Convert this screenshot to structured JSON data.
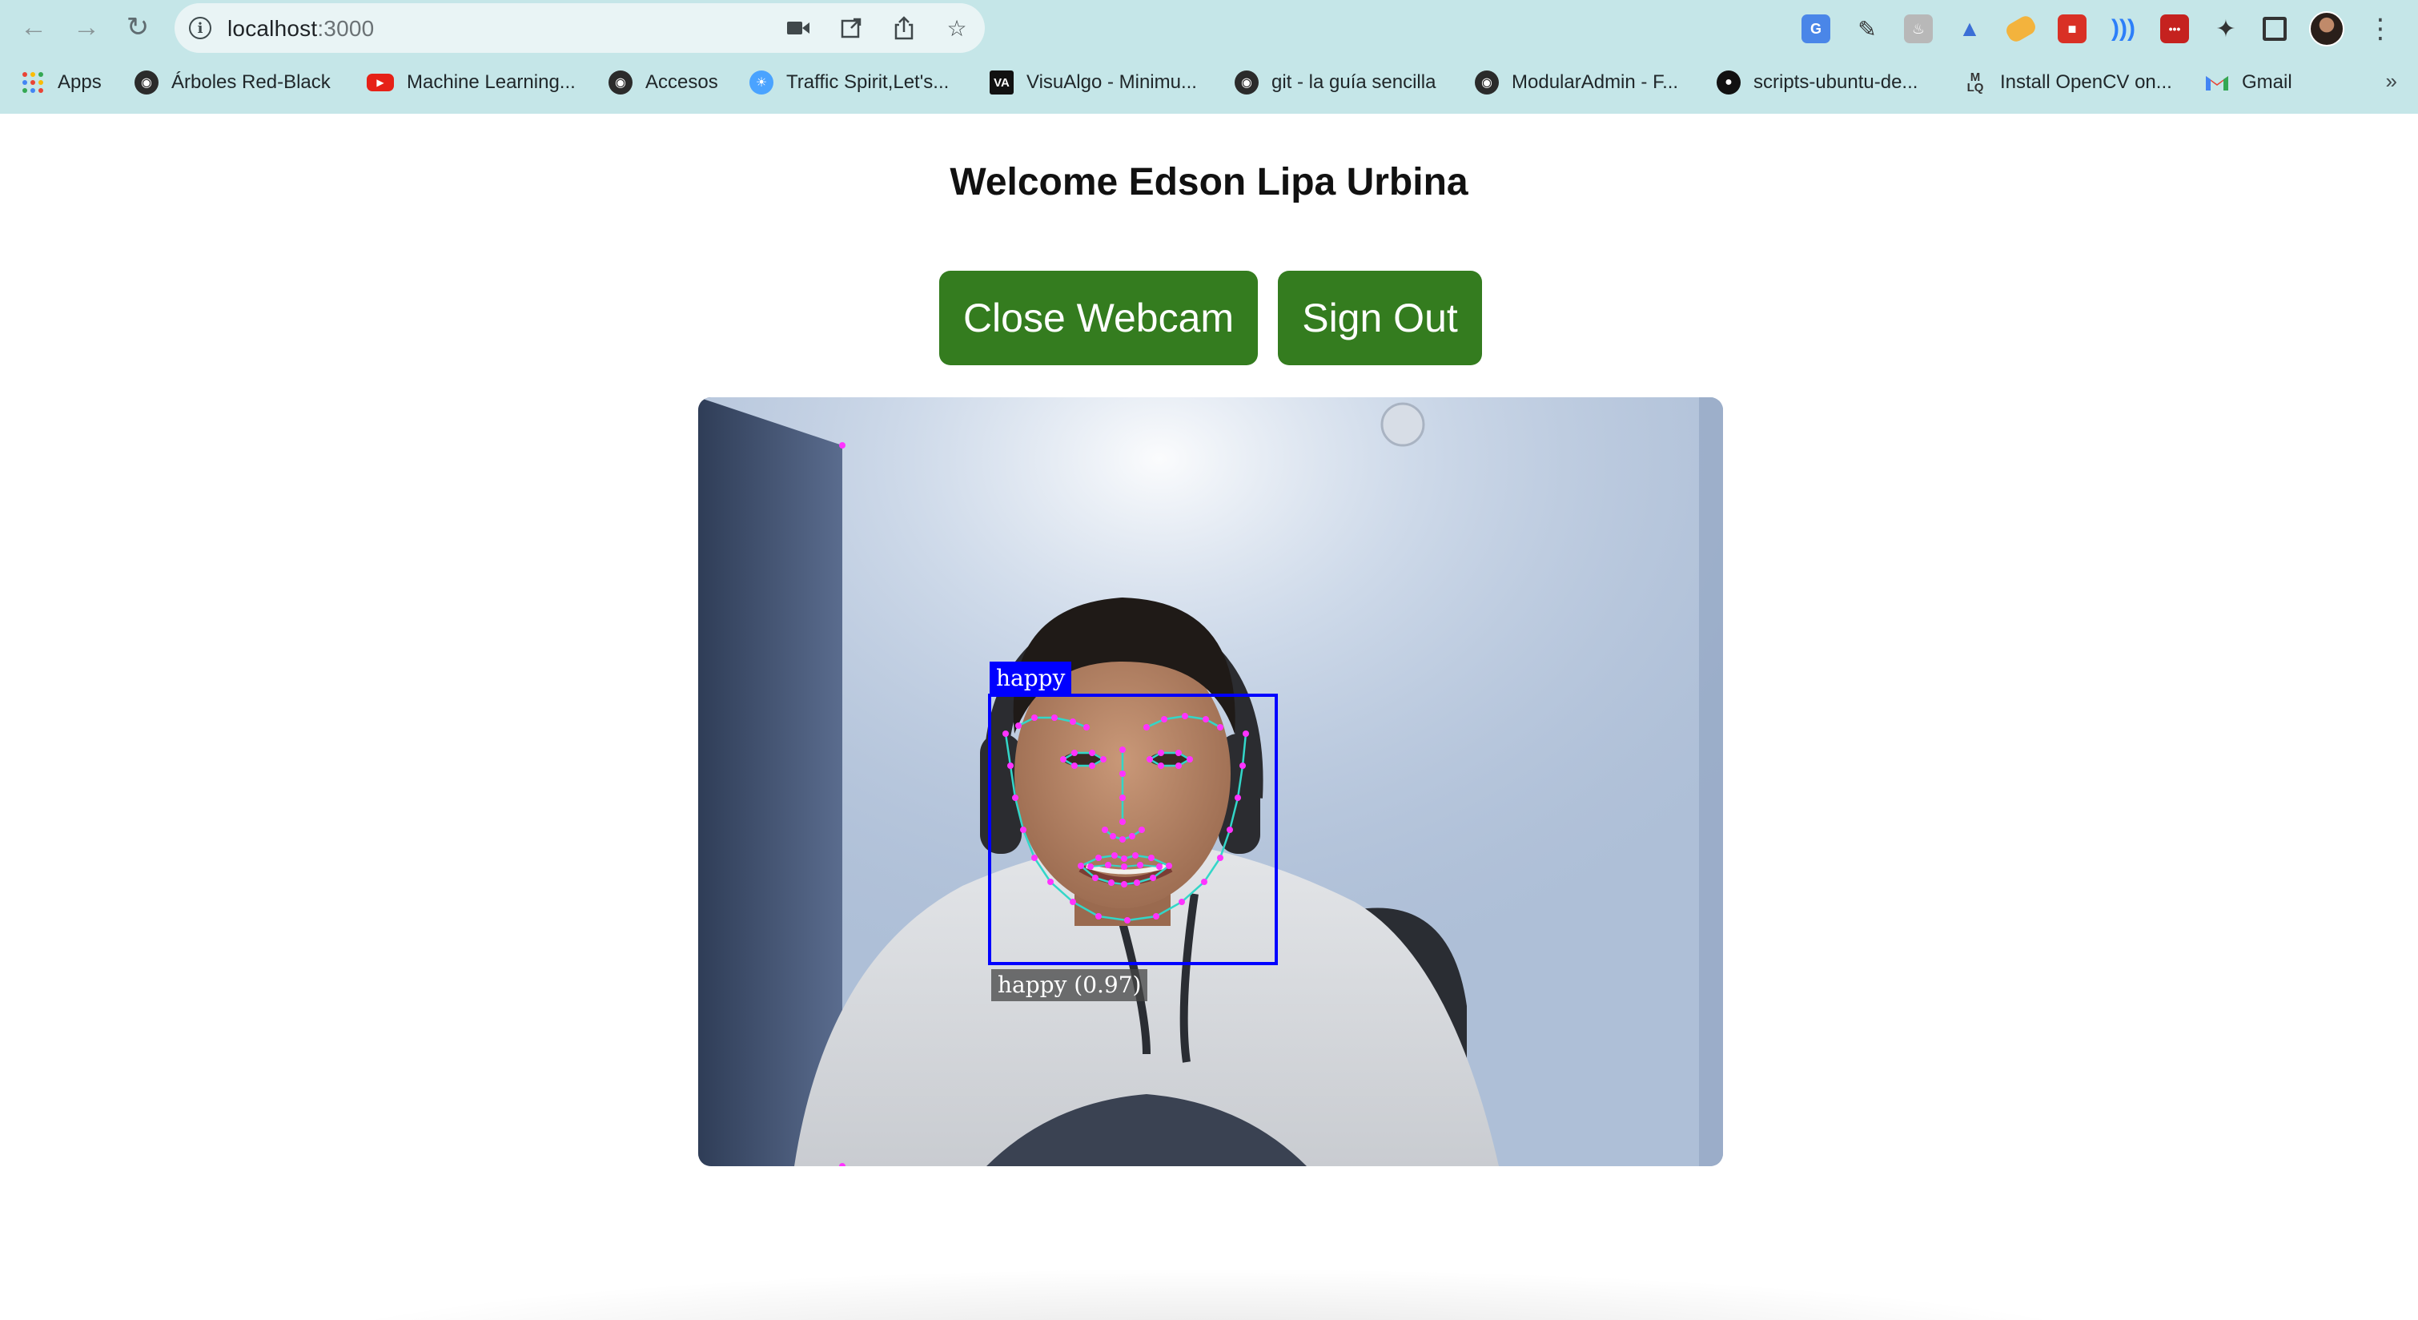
{
  "browser": {
    "url_host": "localhost",
    "url_port": ":3000",
    "bookmarks": [
      {
        "label": "Apps",
        "icon": "apps-grid-icon",
        "color": "#e8453c"
      },
      {
        "label": "Árboles Red-Black",
        "icon": "globe-icon",
        "color": "#2b2b2b"
      },
      {
        "label": "Machine Learning...",
        "icon": "youtube-icon",
        "color": "#e62117"
      },
      {
        "label": "Accesos",
        "icon": "globe-icon",
        "color": "#2b2b2b"
      },
      {
        "label": "Traffic Spirit,Let's...",
        "icon": "traffic-spirit-icon",
        "color": "#4aa3ff"
      },
      {
        "label": "VisuAlgo - Minimu...",
        "icon": "visualgo-icon",
        "color": "#111111"
      },
      {
        "label": "git - la guía sencilla",
        "icon": "globe-icon",
        "color": "#2b2b2b"
      },
      {
        "label": "ModularAdmin - F...",
        "icon": "globe-icon",
        "color": "#2b2b2b"
      },
      {
        "label": "scripts-ubuntu-de...",
        "icon": "github-icon",
        "color": "#111111"
      },
      {
        "label": "Install OpenCV on...",
        "icon": "mlq-icon",
        "color": "#333333"
      },
      {
        "label": "Gmail",
        "icon": "gmail-icon",
        "color": "#ea4335"
      }
    ]
  },
  "page": {
    "welcome": "Welcome Edson Lipa Urbina",
    "close_webcam": "Close Webcam",
    "sign_out": "Sign Out"
  },
  "detection": {
    "top_label": "happy",
    "bottom_label": "happy (0.97)",
    "box_color": "#0000ff",
    "landmark_color": "#ff33ff",
    "contour_color": "#33d6c8"
  }
}
